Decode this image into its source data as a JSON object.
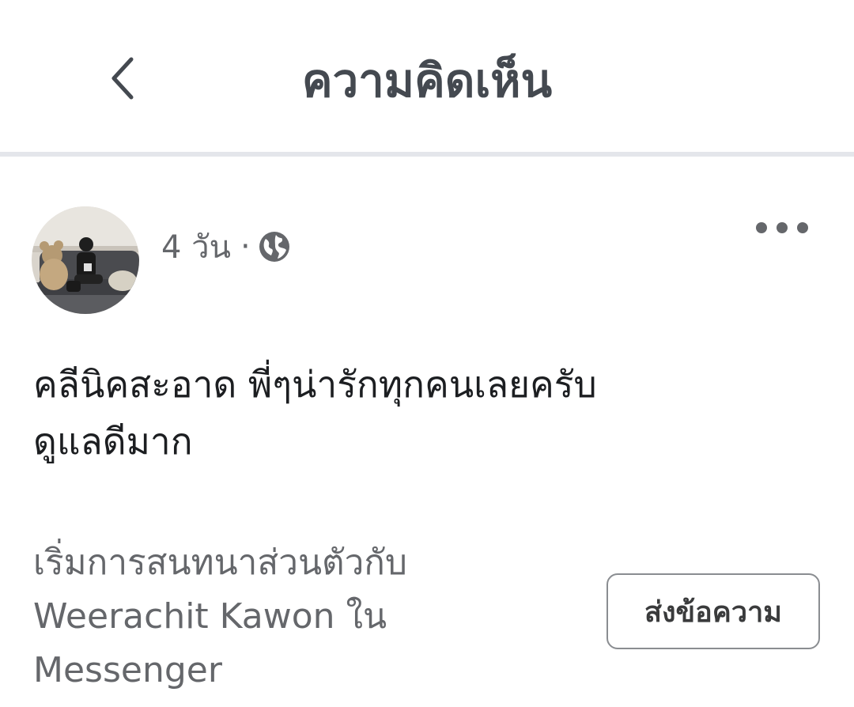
{
  "header": {
    "title": "ความคิดเห็น",
    "back_icon": "chevron-left-icon"
  },
  "post": {
    "time": "4 วัน",
    "separator": "·",
    "privacy_icon": "globe-icon",
    "more_icon": "more-horizontal-icon",
    "comment_lines": [
      "คลีนิคสะอาด พี่ๆน่ารักทุกคนเลยครับ",
      "ดูแลดีมาก"
    ]
  },
  "messenger_prompt": {
    "lines": [
      "เริ่มการสนทนาส่วนตัวกับ",
      "Weerachit Kawon ใน",
      "Messenger"
    ],
    "button_label": "ส่งข้อความ"
  },
  "colors": {
    "title": "#444950",
    "secondary_text": "#65676b",
    "primary_text": "#1c1e21",
    "divider": "#e4e6eb"
  }
}
